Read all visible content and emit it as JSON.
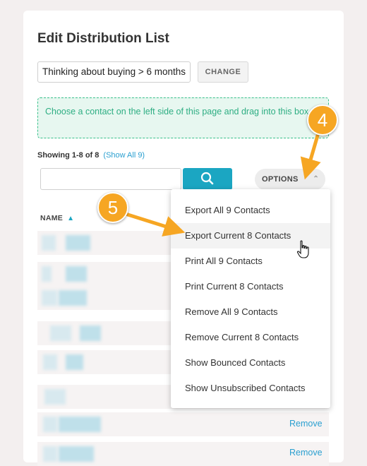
{
  "page": {
    "title": "Edit Distribution List",
    "list_name_value": "Thinking about buying > 6 months",
    "change_label": "CHANGE",
    "drop_hint": "Choose a contact on the left side of this page and drag into this box.",
    "showing_text": "Showing 1-8 of 8",
    "show_all_link": "(Show All 9)",
    "search_value": "",
    "options_label": "OPTIONS",
    "name_header": "NAME",
    "remove_label": "Remove"
  },
  "menu": {
    "items": [
      "Export All 9 Contacts",
      "Export Current 8 Contacts",
      "Print All 9 Contacts",
      "Print Current 8 Contacts",
      "Remove All 9 Contacts",
      "Remove Current 8 Contacts",
      "Show Bounced Contacts",
      "Show Unsubscribed Contacts"
    ]
  },
  "callouts": {
    "step4": "4",
    "step5": "5"
  },
  "icons": {
    "search": "magnifier-icon",
    "chevron": "chevron-up-icon",
    "sort": "sort-asc-icon",
    "cursor": "hand-pointer-icon"
  },
  "colors": {
    "accent": "#1ba6c2",
    "link": "#2a9fd0",
    "drop_green": "#2eae83",
    "callout_orange": "#f6a623"
  }
}
